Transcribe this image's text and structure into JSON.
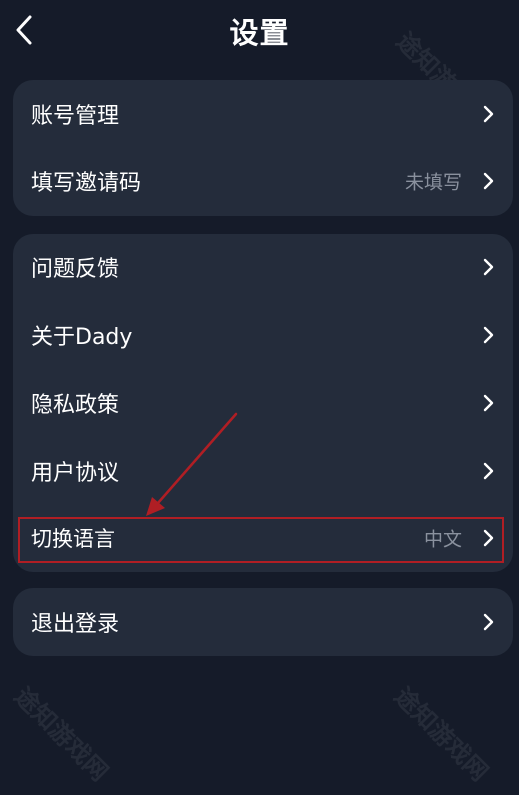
{
  "header": {
    "title": "设置",
    "back_icon": "chevron-left-icon"
  },
  "groups": {
    "account": {
      "items": [
        {
          "label": "账号管理",
          "value": ""
        },
        {
          "label": "填写邀请码",
          "value": "未填写"
        }
      ]
    },
    "info": {
      "items": [
        {
          "label": "问题反馈",
          "value": ""
        },
        {
          "label": "关于Dady",
          "value": ""
        },
        {
          "label": "隐私政策",
          "value": ""
        },
        {
          "label": "用户协议",
          "value": ""
        },
        {
          "label": "切换语言",
          "value": "中文"
        }
      ]
    },
    "session": {
      "items": [
        {
          "label": "退出登录",
          "value": ""
        }
      ]
    }
  },
  "watermark": "途知游戏网",
  "colors": {
    "background": "#151b29",
    "card": "#242c3b",
    "annotation": "#b01e24",
    "value_text": "#8a919e"
  }
}
